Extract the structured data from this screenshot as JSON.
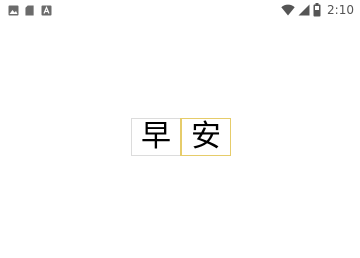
{
  "status_bar": {
    "left_icons": [
      "image-icon",
      "sd-card-icon",
      "font-a-icon"
    ],
    "right_icons": [
      "wifi-icon",
      "signal-icon",
      "battery-icon"
    ],
    "time": "2:10"
  },
  "greeting": {
    "characters": [
      "早",
      "安"
    ]
  },
  "colors": {
    "highlight_border": "#e6cc6a",
    "status_icon": "#555555"
  }
}
